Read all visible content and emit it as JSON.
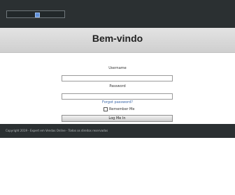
{
  "header": {
    "selector_icon": "square-icon"
  },
  "page_title": "Bem-vindo",
  "login": {
    "username_label": "Username",
    "password_label": "Password",
    "forgot_link": "Forgot password?",
    "remember_label": "Remember Me",
    "submit_label": "Log Me In"
  },
  "footer": {
    "copyright": "Copyright 2019 - Expert em Vendas Online - Todos os direitos reservados"
  }
}
